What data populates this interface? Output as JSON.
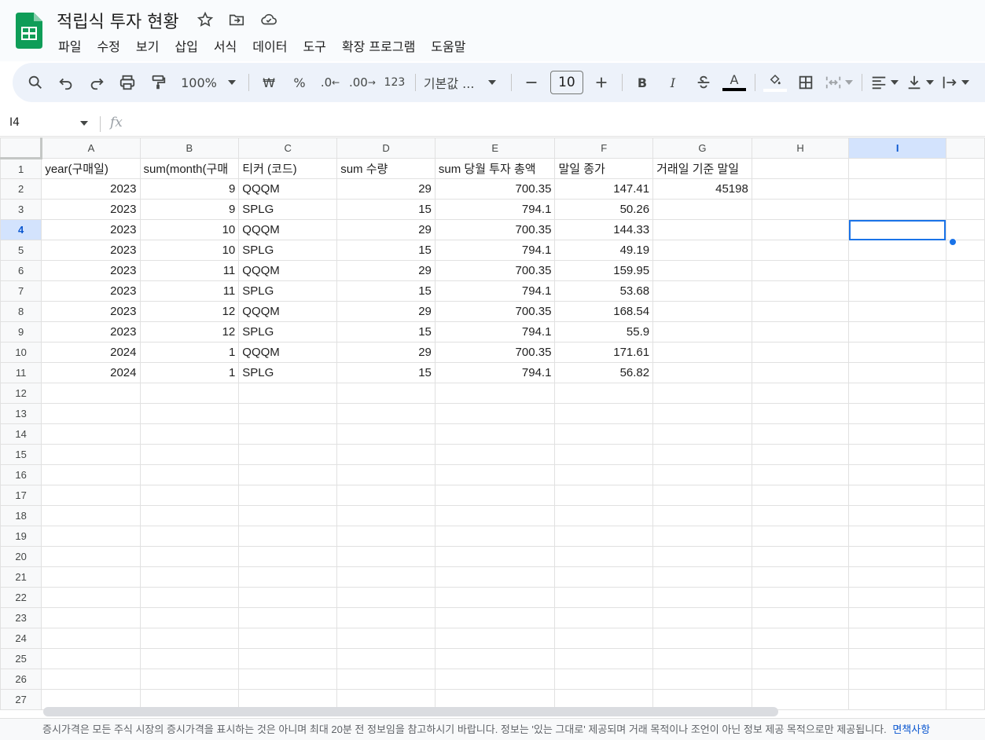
{
  "app": {
    "title": "적립식 투자 현황",
    "accent_color": "#0f9d58",
    "icons": [
      "star-icon",
      "move-folder-icon",
      "cloud-saved-icon"
    ]
  },
  "menu": [
    "파일",
    "수정",
    "보기",
    "삽입",
    "서식",
    "데이터",
    "도구",
    "확장 프로그램",
    "도움말"
  ],
  "toolbar": {
    "zoom": "100%",
    "currency": "₩",
    "percent": "%",
    "decrease_decimal": ".0",
    "increase_decimal": ".00",
    "number_format": "123",
    "font": "기본값 ...",
    "font_size": "10",
    "bold": "B",
    "italic": "I",
    "text_color_letter": "A"
  },
  "formula_bar": {
    "cell_ref": "I4",
    "fx": "fx",
    "value": ""
  },
  "sheet": {
    "columns": [
      "A",
      "B",
      "C",
      "D",
      "E",
      "F",
      "G",
      "H",
      "I"
    ],
    "selected_column": "I",
    "selected_row": 4,
    "row_count": 27,
    "header_row": [
      "year(구매일)",
      "sum(month(구매",
      "티커 (코드)",
      "sum 수량",
      "sum 당월 투자 총액",
      "말일 종가",
      "거래일 기준 말일",
      "",
      ""
    ],
    "rows": [
      [
        "2023",
        "9",
        "QQQM",
        "29",
        "700.35",
        "147.41",
        "45198",
        "",
        ""
      ],
      [
        "2023",
        "9",
        "SPLG",
        "15",
        "794.1",
        "50.26",
        "",
        "",
        ""
      ],
      [
        "2023",
        "10",
        "QQQM",
        "29",
        "700.35",
        "144.33",
        "",
        "",
        ""
      ],
      [
        "2023",
        "10",
        "SPLG",
        "15",
        "794.1",
        "49.19",
        "",
        "",
        ""
      ],
      [
        "2023",
        "11",
        "QQQM",
        "29",
        "700.35",
        "159.95",
        "",
        "",
        ""
      ],
      [
        "2023",
        "11",
        "SPLG",
        "15",
        "794.1",
        "53.68",
        "",
        "",
        ""
      ],
      [
        "2023",
        "12",
        "QQQM",
        "29",
        "700.35",
        "168.54",
        "",
        "",
        ""
      ],
      [
        "2023",
        "12",
        "SPLG",
        "15",
        "794.1",
        "55.9",
        "",
        "",
        ""
      ],
      [
        "2024",
        "1",
        "QQQM",
        "29",
        "700.35",
        "171.61",
        "",
        "",
        ""
      ],
      [
        "2024",
        "1",
        "SPLG",
        "15",
        "794.1",
        "56.82",
        "",
        "",
        ""
      ]
    ]
  },
  "footer": {
    "disclaimer": "증시가격은 모든 주식 시장의 증시가격을 표시하는 것은 아니며 최대 20분 전 정보임을 참고하시기 바랍니다. 정보는 '있는 그대로' 제공되며 거래 목적이나 조언이 아닌 정보 제공 목적으로만 제공됩니다.",
    "link": "면책사항"
  }
}
